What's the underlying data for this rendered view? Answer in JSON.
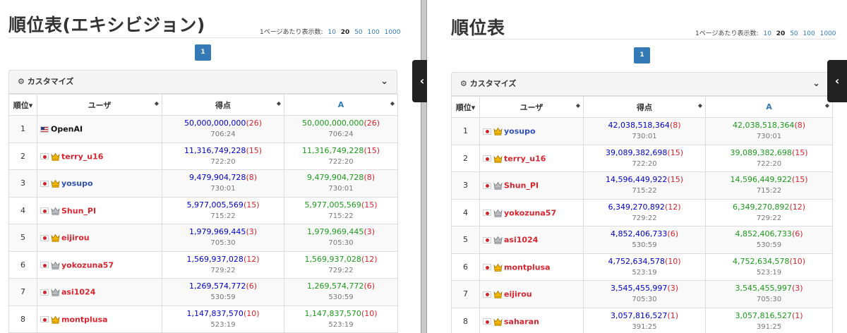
{
  "colors": {
    "accent": "#337ab7",
    "score": "#0000cc",
    "scoreA": "#1a9b1a",
    "penalty": "#d9232d"
  },
  "left": {
    "title": "順位表(エキシビジョン)",
    "per_page_label": "1ページあたり表示数:",
    "per_page_options": [
      "10",
      "20",
      "50",
      "100",
      "1000"
    ],
    "per_page_selected": "20",
    "page": "1",
    "customize": "カスタマイズ",
    "headers": {
      "rank": "順位",
      "user": "ユーザ",
      "score": "得点",
      "a": "A"
    },
    "rows": [
      {
        "rank": "1",
        "flag": "us",
        "crown": "",
        "user": "OpenAI",
        "user_color": "black",
        "score": "50,000,000,000",
        "pen": "(26)",
        "time": "706:24",
        "a": "50,000,000,000",
        "a_pen": "(26)",
        "a_time": "706:24"
      },
      {
        "rank": "2",
        "flag": "jp",
        "crown": "gold",
        "user": "terry_u16",
        "user_color": "red",
        "score": "11,316,749,228",
        "pen": "(15)",
        "time": "722:20",
        "a": "11,316,749,228",
        "a_pen": "(15)",
        "a_time": "722:20"
      },
      {
        "rank": "3",
        "flag": "jp",
        "crown": "gold",
        "user": "yosupo",
        "user_color": "blue",
        "score": "9,479,904,728",
        "pen": "(8)",
        "time": "730:01",
        "a": "9,479,904,728",
        "a_pen": "(8)",
        "a_time": "730:01"
      },
      {
        "rank": "4",
        "flag": "jp",
        "crown": "silver",
        "user": "Shun_PI",
        "user_color": "red",
        "score": "5,977,005,569",
        "pen": "(15)",
        "time": "715:22",
        "a": "5,977,005,569",
        "a_pen": "(15)",
        "a_time": "715:22"
      },
      {
        "rank": "5",
        "flag": "jp",
        "crown": "gold",
        "user": "eijirou",
        "user_color": "red",
        "score": "1,979,969,445",
        "pen": "(3)",
        "time": "705:30",
        "a": "1,979,969,445",
        "a_pen": "(3)",
        "a_time": "705:30"
      },
      {
        "rank": "6",
        "flag": "jp",
        "crown": "silver",
        "user": "yokozuna57",
        "user_color": "red",
        "score": "1,569,937,028",
        "pen": "(12)",
        "time": "729:22",
        "a": "1,569,937,028",
        "a_pen": "(12)",
        "a_time": "729:22"
      },
      {
        "rank": "7",
        "flag": "jp",
        "crown": "silver",
        "user": "asi1024",
        "user_color": "red",
        "score": "1,269,574,772",
        "pen": "(6)",
        "time": "530:59",
        "a": "1,269,574,772",
        "a_pen": "(6)",
        "a_time": "530:59"
      },
      {
        "rank": "8",
        "flag": "jp",
        "crown": "gold",
        "user": "montplusa",
        "user_color": "red",
        "score": "1,147,837,570",
        "pen": "(10)",
        "time": "523:19",
        "a": "1,147,837,570",
        "a_pen": "(10)",
        "a_time": "523:19"
      }
    ]
  },
  "right": {
    "title": "順位表",
    "per_page_label": "1ページあたり表示数:",
    "per_page_options": [
      "10",
      "20",
      "50",
      "100",
      "1000"
    ],
    "per_page_selected": "20",
    "page": "1",
    "customize": "カスタマイズ",
    "headers": {
      "rank": "順位",
      "user": "ユーザ",
      "score": "得点",
      "a": "A"
    },
    "rows": [
      {
        "rank": "1",
        "flag": "jp",
        "crown": "gold",
        "user": "yosupo",
        "user_color": "blue",
        "score": "42,038,518,364",
        "pen": "(8)",
        "time": "730:01",
        "a": "42,038,518,364",
        "a_pen": "(8)",
        "a_time": "730:01"
      },
      {
        "rank": "2",
        "flag": "jp",
        "crown": "gold",
        "user": "terry_u16",
        "user_color": "red",
        "score": "39,089,382,698",
        "pen": "(15)",
        "time": "722:20",
        "a": "39,089,382,698",
        "a_pen": "(15)",
        "a_time": "722:20"
      },
      {
        "rank": "3",
        "flag": "jp",
        "crown": "silver",
        "user": "Shun_PI",
        "user_color": "red",
        "score": "14,596,449,922",
        "pen": "(15)",
        "time": "715:22",
        "a": "14,596,449,922",
        "a_pen": "(15)",
        "a_time": "715:22"
      },
      {
        "rank": "4",
        "flag": "jp",
        "crown": "silver",
        "user": "yokozuna57",
        "user_color": "red",
        "score": "6,349,270,892",
        "pen": "(12)",
        "time": "729:22",
        "a": "6,349,270,892",
        "a_pen": "(12)",
        "a_time": "729:22"
      },
      {
        "rank": "5",
        "flag": "jp",
        "crown": "silver",
        "user": "asi1024",
        "user_color": "red",
        "score": "4,852,406,733",
        "pen": "(6)",
        "time": "530:59",
        "a": "4,852,406,733",
        "a_pen": "(6)",
        "a_time": "530:59"
      },
      {
        "rank": "6",
        "flag": "jp",
        "crown": "gold",
        "user": "montplusa",
        "user_color": "red",
        "score": "4,752,634,578",
        "pen": "(10)",
        "time": "523:19",
        "a": "4,752,634,578",
        "a_pen": "(10)",
        "a_time": "523:19"
      },
      {
        "rank": "7",
        "flag": "jp",
        "crown": "gold",
        "user": "eijirou",
        "user_color": "red",
        "score": "3,545,455,997",
        "pen": "(3)",
        "time": "705:30",
        "a": "3,545,455,997",
        "a_pen": "(3)",
        "a_time": "705:30"
      },
      {
        "rank": "8",
        "flag": "jp",
        "crown": "gold",
        "user": "saharan",
        "user_color": "red",
        "score": "3,057,816,527",
        "pen": "(1)",
        "time": "391:25",
        "a": "3,057,816,527",
        "a_pen": "(1)",
        "a_time": "391:25"
      }
    ]
  }
}
